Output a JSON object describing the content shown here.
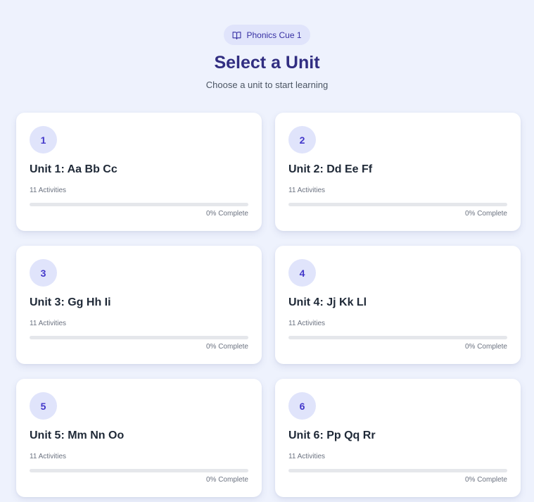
{
  "header": {
    "badge_label": "Phonics Cue 1",
    "badge_icon": "book-open-icon",
    "title": "Select a Unit",
    "subtitle": "Choose a unit to start learning"
  },
  "units": [
    {
      "number": "1",
      "title": "Unit 1: Aa Bb Cc",
      "activities": "11 Activities",
      "progress": 0,
      "complete_label": "0% Complete"
    },
    {
      "number": "2",
      "title": "Unit 2: Dd Ee Ff",
      "activities": "11 Activities",
      "progress": 0,
      "complete_label": "0% Complete"
    },
    {
      "number": "3",
      "title": "Unit 3: Gg Hh Ii",
      "activities": "11 Activities",
      "progress": 0,
      "complete_label": "0% Complete"
    },
    {
      "number": "4",
      "title": "Unit 4: Jj Kk Ll",
      "activities": "11 Activities",
      "progress": 0,
      "complete_label": "0% Complete"
    },
    {
      "number": "5",
      "title": "Unit 5: Mm Nn Oo",
      "activities": "11 Activities",
      "progress": 0,
      "complete_label": "0% Complete"
    },
    {
      "number": "6",
      "title": "Unit 6: Pp Qq Rr",
      "activities": "11 Activities",
      "progress": 0,
      "complete_label": "0% Complete"
    }
  ],
  "colors": {
    "background": "#eef2fd",
    "accent": "#312e81",
    "badge_bg": "#e0e4fb",
    "number_text": "#4338ca",
    "progress_track": "#e5e7eb"
  }
}
